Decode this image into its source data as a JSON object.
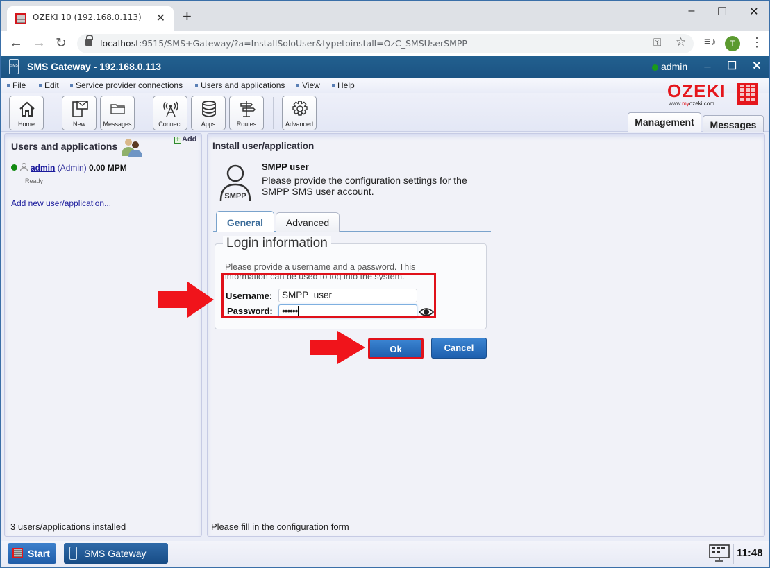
{
  "browser": {
    "tab_title": "OZEKI 10 (192.168.0.113)",
    "url_host": "localhost",
    "url_rest": ":9515/SMS+Gateway/?a=InstallSoloUser&typetoinstall=OzC_SMSUserSMPP",
    "profile_initial": "T",
    "icons": [
      "back-icon",
      "forward-icon",
      "reload-icon",
      "lock-icon",
      "key-icon",
      "star-icon",
      "media-icon",
      "menu-icon"
    ]
  },
  "app": {
    "title": "SMS Gateway - 192.168.0.113",
    "logo_text": "SMS",
    "user": "admin",
    "user_status_color": "#1a9b1a",
    "accent_color": "#1b5383"
  },
  "menu": {
    "items": [
      "File",
      "Edit",
      "Service provider connections",
      "Users and applications",
      "View",
      "Help"
    ]
  },
  "toolbar": {
    "buttons": [
      {
        "label": "Home",
        "icon": "home-icon"
      },
      {
        "label": "New",
        "icon": "new-message-icon"
      },
      {
        "label": "Messages",
        "icon": "folder-icon"
      },
      {
        "label": "Connect",
        "icon": "antenna-icon"
      },
      {
        "label": "Apps",
        "icon": "database-icon"
      },
      {
        "label": "Routes",
        "icon": "signpost-icon"
      },
      {
        "label": "Advanced",
        "icon": "gear-icon"
      }
    ]
  },
  "brand": {
    "name": "OZEKI",
    "url_prefix": "www.",
    "url_highlight": "my",
    "url_suffix": "ozeki.com",
    "color": "#e5161c"
  },
  "view_tabs": {
    "management": "Management",
    "messages": "Messages"
  },
  "left_panel": {
    "title": "Users and applications",
    "add_label": "Add",
    "users": [
      {
        "name": "admin",
        "role": "(Admin)",
        "rate": "0.00 MPM",
        "status": "Ready"
      }
    ],
    "add_new_link": "Add new user/application...",
    "footer": "3 users/applications installed"
  },
  "right_panel": {
    "title": "Install user/application",
    "icon_label": "SMPP",
    "heading": "SMPP user",
    "description": "Please provide the configuration settings for the SMPP SMS user account.",
    "tabs": [
      "General",
      "Advanced"
    ],
    "fieldset": {
      "legend": "Login information",
      "description": "Please provide a username and a password. This information can be used to log into the system.",
      "username_label": "Username:",
      "username_value": "SMPP_user",
      "password_label": "Password:",
      "password_value": "••••••"
    },
    "ok_label": "Ok",
    "cancel_label": "Cancel",
    "footer": "Please fill in the configuration form"
  },
  "taskbar": {
    "start_label": "Start",
    "task_label": "SMS Gateway",
    "clock": "11:48"
  },
  "annotations": {
    "highlight_color": "#e0111a"
  }
}
